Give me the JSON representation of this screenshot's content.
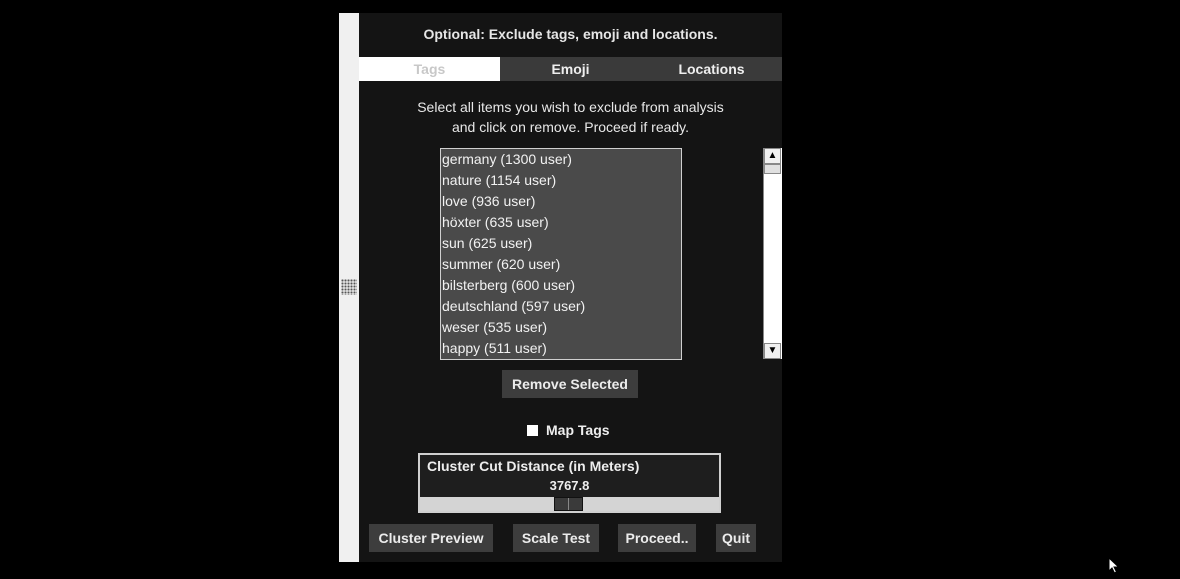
{
  "header": {
    "title": "Optional: Exclude tags, emoji and locations."
  },
  "tabs": [
    {
      "label": "Tags",
      "active": true
    },
    {
      "label": "Emoji",
      "active": false
    },
    {
      "label": "Locations",
      "active": false
    }
  ],
  "instructions": {
    "line1": "Select all items you wish to exclude from analysis",
    "line2": "and click on remove. Proceed if ready."
  },
  "list": {
    "items": [
      "germany (1300 user)",
      "nature (1154 user)",
      "love (936 user)",
      "höxter (635 user)",
      "sun (625 user)",
      "summer (620 user)",
      "bilsterberg (600 user)",
      "deutschland (597 user)",
      "weser (535 user)",
      "happy (511 user)"
    ]
  },
  "remove_button": {
    "label": "Remove Selected"
  },
  "map_tags": {
    "label": "Map Tags",
    "checked": false
  },
  "cluster": {
    "title": "Cluster Cut Distance (in Meters)",
    "value": "3767.8"
  },
  "footer_buttons": {
    "cluster_preview": "Cluster Preview",
    "scale_test": "Scale Test",
    "proceed": "Proceed..",
    "quit": "Quit"
  },
  "colors": {
    "panel_bg": "#141414",
    "button_bg": "#3d3d3d",
    "list_bg": "#4a4a4a",
    "active_tab_bg": "#ffffff"
  }
}
